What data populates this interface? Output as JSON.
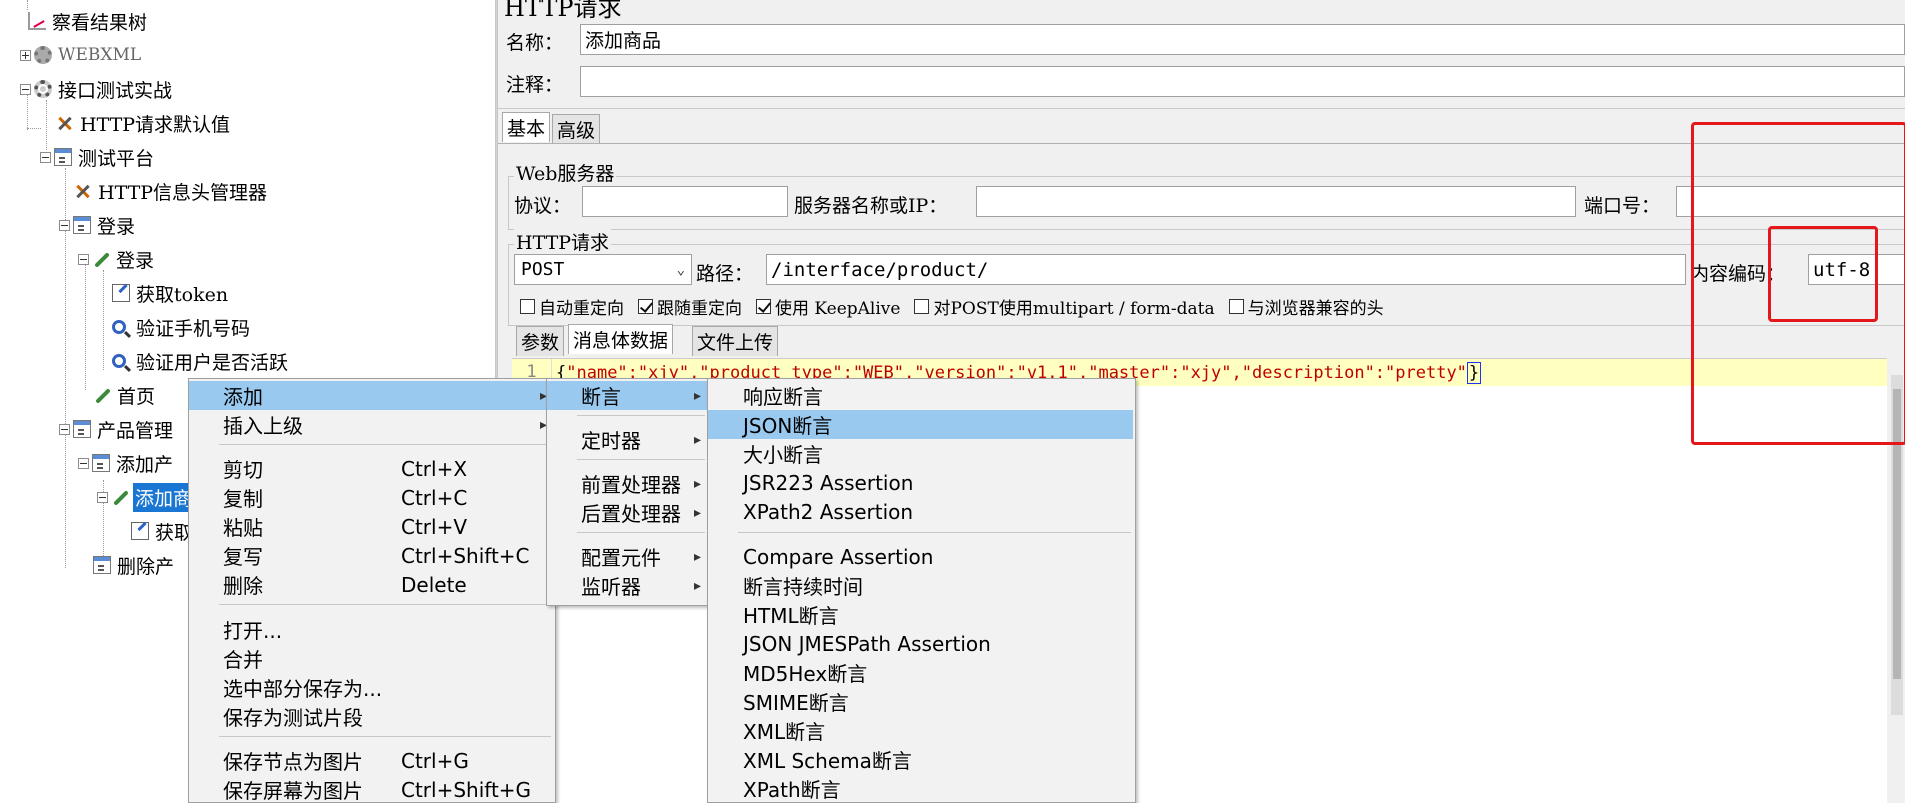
{
  "tree": {
    "nodes": [
      {
        "label": "察看结果树"
      },
      {
        "label": "WEBXML"
      },
      {
        "label": "接口测试实战"
      },
      {
        "label": "HTTP请求默认值"
      },
      {
        "label": "测试平台"
      },
      {
        "label": "HTTP信息头管理器"
      },
      {
        "label": "登录"
      },
      {
        "label": "登录"
      },
      {
        "label": "获取token"
      },
      {
        "label": "验证手机号码"
      },
      {
        "label": "验证用户是否活跃"
      },
      {
        "label": "首页"
      },
      {
        "label": "产品管理"
      },
      {
        "label": "添加产"
      },
      {
        "label": "添加商"
      },
      {
        "label": "获取"
      },
      {
        "label": "删除产"
      }
    ]
  },
  "editor": {
    "header": "HTTP请求",
    "name_label": "名称：",
    "name_value": "添加商品",
    "comment_label": "注释：",
    "comment_value": "",
    "tabs": [
      {
        "label": "基本"
      },
      {
        "label": "高级"
      }
    ],
    "web_server": {
      "title": "Web服务器",
      "protocol_label": "协议：",
      "protocol_value": "",
      "server_label": "服务器名称或IP：",
      "server_value": "",
      "port_label": "端口号：",
      "port_value": ""
    },
    "http_request": {
      "title": "HTTP请求",
      "method": "POST",
      "path_label": "路径：",
      "path_value": "/interface/product/",
      "encoding_label": "内容编码：",
      "encoding_value": "utf-8",
      "checkboxes": [
        {
          "label": "自动重定向",
          "checked": false
        },
        {
          "label": "跟随重定向",
          "checked": true
        },
        {
          "label": "使用 KeepAlive",
          "checked": true
        },
        {
          "label": "对POST使用multipart / form-data",
          "checked": false
        },
        {
          "label": "与浏览器兼容的头",
          "checked": false
        }
      ]
    },
    "body_tabs": [
      {
        "label": "参数"
      },
      {
        "label": "消息体数据"
      },
      {
        "label": "文件上传"
      }
    ],
    "code": {
      "line_number": "1",
      "open_brace": "{",
      "content": "\"name\":\"xjy\",\"product_type\":\"WEB\",\"version\":\"v1.1\",\"master\":\"xjy\",\"description\":\"pretty\"",
      "close_brace": "}"
    }
  },
  "context_menu": {
    "items": [
      {
        "label": "添加",
        "shortcut": "",
        "submenu": true
      },
      {
        "label": "插入上级",
        "shortcut": "",
        "submenu": true
      },
      {
        "label": "剪切",
        "shortcut": "Ctrl+X"
      },
      {
        "label": "复制",
        "shortcut": "Ctrl+C"
      },
      {
        "label": "粘贴",
        "shortcut": "Ctrl+V"
      },
      {
        "label": "复写",
        "shortcut": "Ctrl+Shift+C"
      },
      {
        "label": "删除",
        "shortcut": "Delete"
      },
      {
        "label": "打开..."
      },
      {
        "label": "合并"
      },
      {
        "label": "选中部分保存为..."
      },
      {
        "label": "保存为测试片段"
      },
      {
        "label": "保存节点为图片",
        "shortcut": "Ctrl+G"
      },
      {
        "label": "保存屏幕为图片",
        "shortcut": "Ctrl+Shift+G"
      }
    ]
  },
  "add_submenu": {
    "items": [
      {
        "label": "断言"
      },
      {
        "label": "定时器"
      },
      {
        "label": "前置处理器"
      },
      {
        "label": "后置处理器"
      },
      {
        "label": "配置元件"
      },
      {
        "label": "监听器"
      }
    ]
  },
  "assertion_submenu": {
    "items": [
      {
        "label": "响应断言"
      },
      {
        "label": "JSON断言"
      },
      {
        "label": "大小断言"
      },
      {
        "label": "JSR223 Assertion"
      },
      {
        "label": "XPath2 Assertion"
      },
      {
        "label": "Compare Assertion"
      },
      {
        "label": "断言持续时间"
      },
      {
        "label": "HTML断言"
      },
      {
        "label": "JSON JMESPath Assertion"
      },
      {
        "label": "MD5Hex断言"
      },
      {
        "label": "SMIME断言"
      },
      {
        "label": "XML断言"
      },
      {
        "label": "XML Schema断言"
      },
      {
        "label": "XPath断言"
      }
    ]
  },
  "colors": {
    "highlight": "#99c9ef",
    "selection": "#1976d2",
    "annotation_red": "#e4171b",
    "code_string": "#c00000",
    "code_line_bg": "#ffffbf"
  }
}
